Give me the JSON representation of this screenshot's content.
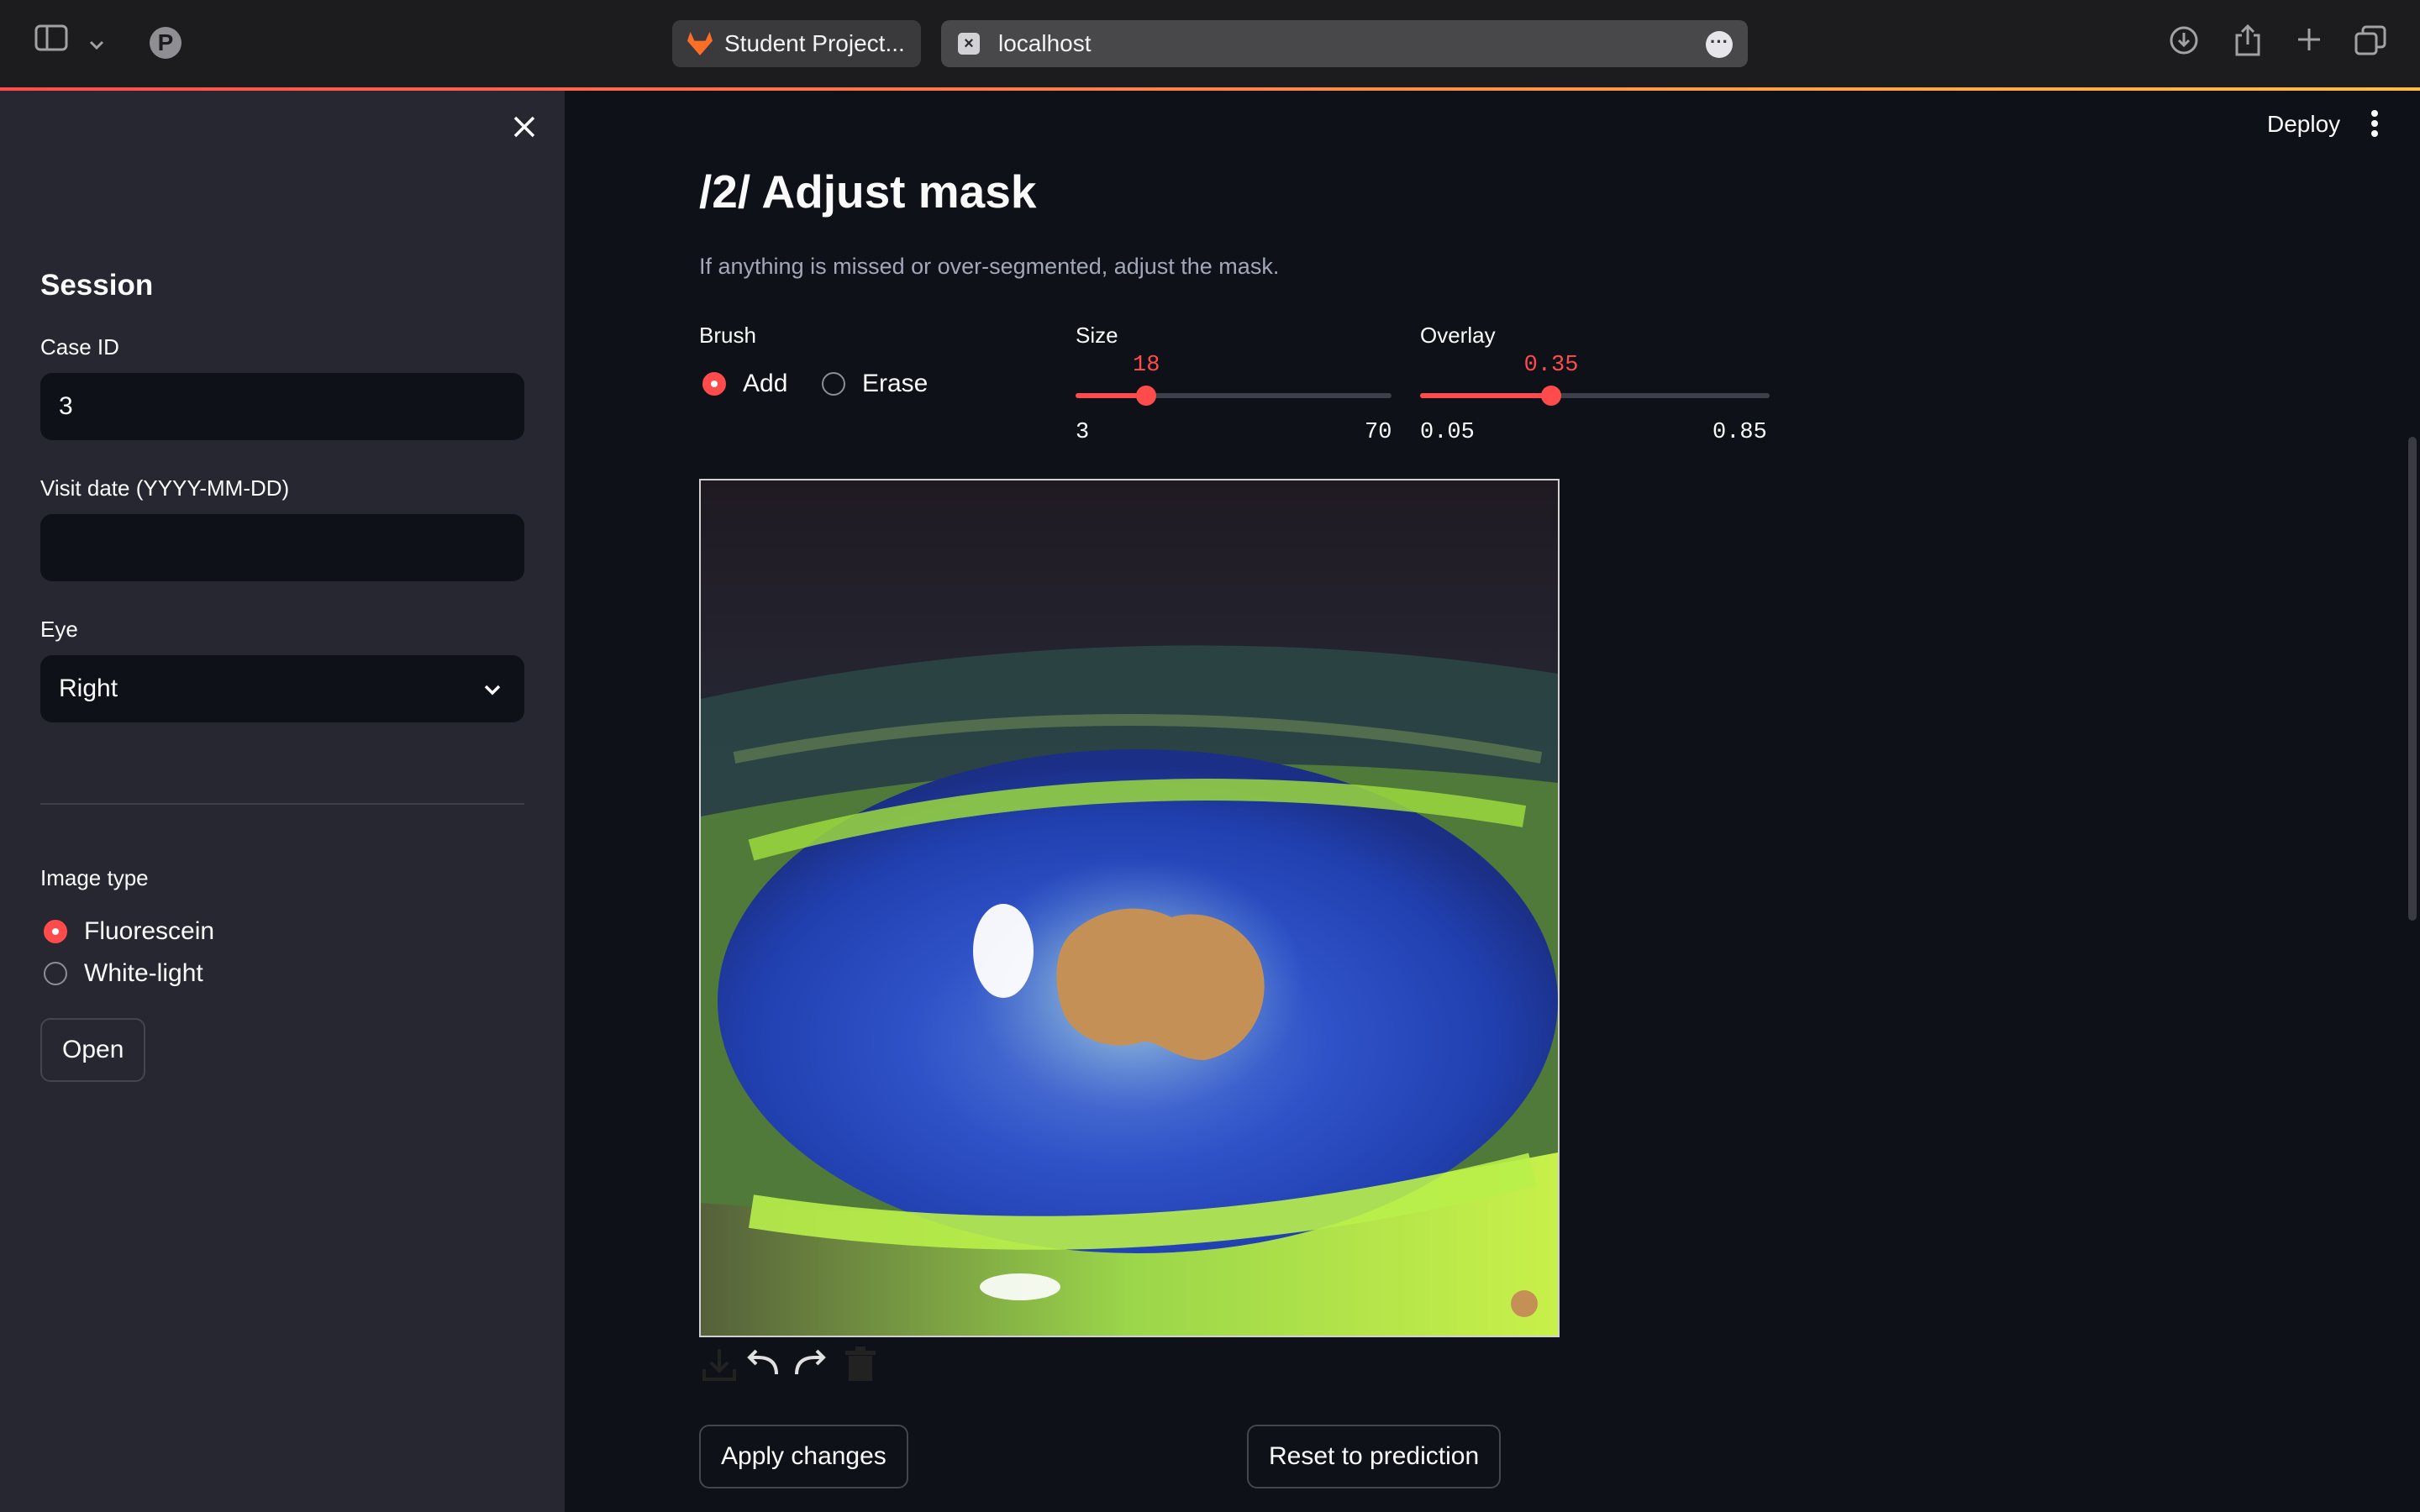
{
  "browser": {
    "tabs": [
      {
        "label": "Student Project..."
      },
      {
        "label": "localhost"
      }
    ],
    "icons": [
      "sidebar-toggle-icon",
      "chevron-down-icon",
      "pinterest-icon",
      "download-icon",
      "share-icon",
      "new-tab-icon",
      "tab-overview-icon",
      "more-icon"
    ]
  },
  "sidebar": {
    "heading": "Session",
    "case_id_label": "Case ID",
    "case_id_value": "3",
    "visit_date_label": "Visit date (YYYY-MM-DD)",
    "visit_date_value": "",
    "eye_label": "Eye",
    "eye_value": "Right",
    "image_type_label": "Image type",
    "image_type_options": [
      "Fluorescein",
      "White-light"
    ],
    "image_type_selected": "Fluorescein",
    "open_label": "Open"
  },
  "header": {
    "deploy_label": "Deploy"
  },
  "main": {
    "title": "/2/ Adjust mask",
    "caption": "If anything is missed or over-segmented, adjust the mask.",
    "brush": {
      "label": "Brush",
      "options": [
        "Add",
        "Erase"
      ],
      "selected": "Add"
    },
    "size": {
      "label": "Size",
      "value": "18",
      "min": "3",
      "max": "70",
      "fraction": 0.224
    },
    "overlay": {
      "label": "Overlay",
      "value": "0.35",
      "min": "0.05",
      "max": "0.85",
      "fraction": 0.375
    },
    "canvas_tools": [
      "download-icon",
      "undo-icon",
      "redo-icon",
      "trash-icon"
    ],
    "apply_label": "Apply changes",
    "reset_label": "Reset to prediction"
  },
  "colors": {
    "accent": "#ff4b4b",
    "background": "#0e1117",
    "sidebar": "#262730",
    "mask": "#c59055"
  }
}
